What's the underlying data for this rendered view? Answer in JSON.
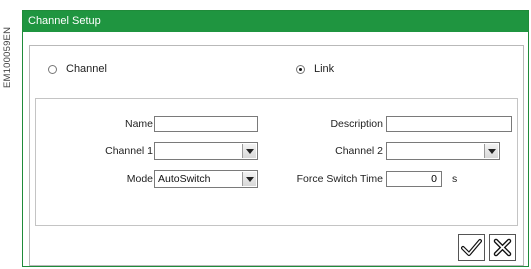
{
  "reference_code": "EM100059EN",
  "window": {
    "title": "Channel Setup"
  },
  "mode": {
    "options": [
      {
        "label": "Channel",
        "selected": false
      },
      {
        "label": "Link",
        "selected": true
      }
    ]
  },
  "form": {
    "name": {
      "label": "Name",
      "value": ""
    },
    "description": {
      "label": "Description",
      "value": ""
    },
    "channel1": {
      "label": "Channel 1",
      "value": ""
    },
    "channel2": {
      "label": "Channel 2",
      "value": ""
    },
    "mode": {
      "label": "Mode",
      "value": "AutoSwitch"
    },
    "force_switch_time": {
      "label": "Force Switch Time",
      "value": "0",
      "unit": "s"
    }
  },
  "icons": {
    "confirm": "checkmark-icon",
    "cancel": "cancel-x-icon"
  },
  "colors": {
    "title_bar": "#1f9540",
    "border": "#1f8b3a"
  }
}
